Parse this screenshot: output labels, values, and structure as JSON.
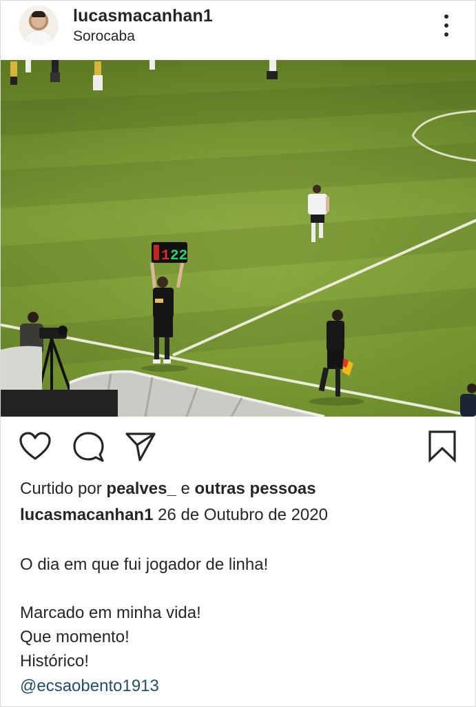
{
  "post": {
    "username": "lucasmacanhan1",
    "location": "Sorocaba",
    "board": {
      "left": "1",
      "right": "22"
    },
    "likes": {
      "prefix": "Curtido por",
      "user": "pealves_",
      "joiner": "e",
      "others": "outras pessoas"
    },
    "caption": {
      "username": "lucasmacanhan1",
      "date": "26 de Outubro de 2020",
      "line1": "O dia em que fui jogador de linha!",
      "line2": "Marcado em minha vida!",
      "line3": "Que momento!",
      "line4": "Histórico!",
      "mention": "@ecsaobento1913"
    }
  },
  "icons": {
    "like": "heart-icon",
    "comment": "comment-icon",
    "share": "paper-plane-icon",
    "save": "bookmark-icon",
    "more": "more-vertical-icon"
  },
  "colors": {
    "text": "#262626",
    "mention": "#1f4e6e",
    "pitch": "#6f8a2c"
  }
}
